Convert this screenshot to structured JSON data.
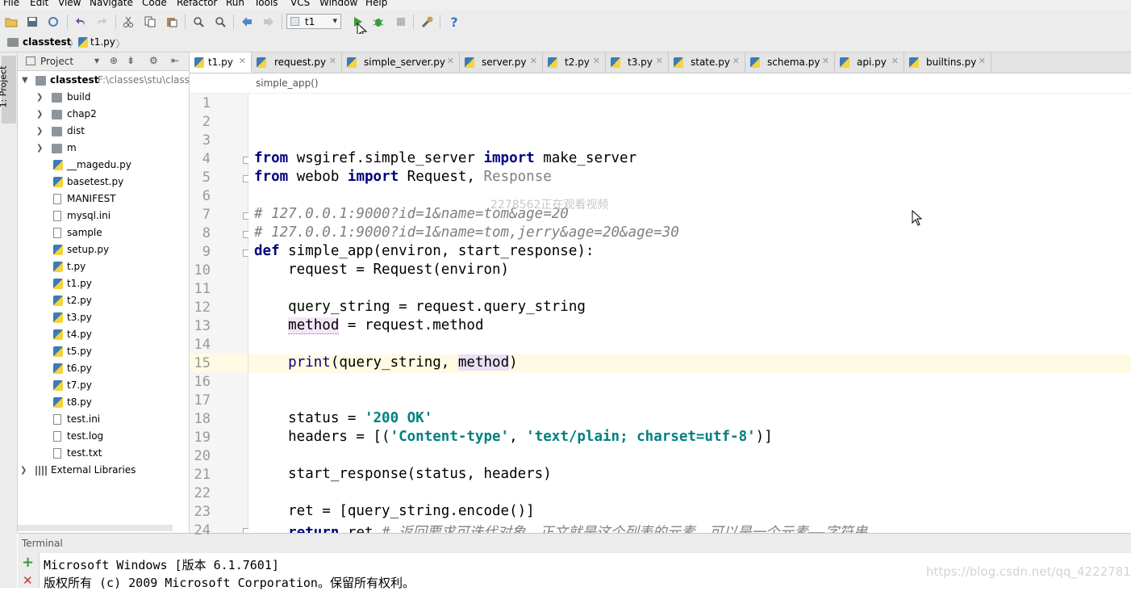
{
  "menu": [
    "File",
    "Edit",
    "View",
    "Navigate",
    "Code",
    "Refactor",
    "Run",
    "Tools",
    "VCS",
    "Window",
    "Help"
  ],
  "toolbar": {
    "run_config": "t1",
    "icons": [
      "open-icon",
      "save-icon",
      "sync-icon",
      "undo-icon",
      "redo-icon",
      "cut-icon",
      "copy-icon",
      "paste-icon",
      "find-icon",
      "replace-icon",
      "back-icon",
      "forward-icon",
      "run-icon",
      "debug-icon",
      "stop-icon",
      "settings-icon",
      "help-icon"
    ]
  },
  "navbar": {
    "project": "classtest",
    "file": "t1.py"
  },
  "stripe": {
    "label": "1: Project"
  },
  "project_panel": {
    "title": "Project",
    "root": {
      "name": "classtest",
      "path": "F:\\classes\\stu\\classt"
    },
    "items": [
      {
        "name": "build",
        "type": "folder"
      },
      {
        "name": "chap2",
        "type": "folder"
      },
      {
        "name": "dist",
        "type": "folder"
      },
      {
        "name": "m",
        "type": "folder"
      },
      {
        "name": "__magedu.py",
        "type": "py"
      },
      {
        "name": "basetest.py",
        "type": "py"
      },
      {
        "name": "MANIFEST",
        "type": "txt"
      },
      {
        "name": "mysql.ini",
        "type": "txt"
      },
      {
        "name": "sample",
        "type": "txt"
      },
      {
        "name": "setup.py",
        "type": "py"
      },
      {
        "name": "t.py",
        "type": "py"
      },
      {
        "name": "t1.py",
        "type": "py"
      },
      {
        "name": "t2.py",
        "type": "py"
      },
      {
        "name": "t3.py",
        "type": "py"
      },
      {
        "name": "t4.py",
        "type": "py"
      },
      {
        "name": "t5.py",
        "type": "py"
      },
      {
        "name": "t6.py",
        "type": "py"
      },
      {
        "name": "t7.py",
        "type": "py"
      },
      {
        "name": "t8.py",
        "type": "py"
      },
      {
        "name": "test.ini",
        "type": "txt"
      },
      {
        "name": "test.log",
        "type": "txt"
      },
      {
        "name": "test.txt",
        "type": "txt"
      }
    ],
    "external": "External Libraries"
  },
  "tabs": [
    "t1.py",
    "request.py",
    "simple_server.py",
    "server.py",
    "t2.py",
    "t3.py",
    "state.py",
    "schema.py",
    "api.py",
    "builtins.py"
  ],
  "active_tab": "t1.py",
  "breadcrumb": "simple_app()",
  "line_numbers": [
    "1",
    "2",
    "3",
    "4",
    "5",
    "6",
    "7",
    "8",
    "9",
    "10",
    "11",
    "12",
    "13",
    "14",
    "15",
    "16",
    "17",
    "18",
    "19",
    "20",
    "21",
    "22",
    "23",
    "24"
  ],
  "code": {
    "l4": {
      "kw1": "from",
      "t1": " wsgiref.simple_server ",
      "kw2": "import",
      "t2": " make_server"
    },
    "l5": {
      "kw1": "from",
      "t1": " webob ",
      "kw2": "import",
      "t2": " Request, ",
      "dim": "Response"
    },
    "l7": "# 127.0.0.1:9000?id=1&name=tom&age=20",
    "l8": "# 127.0.0.1:9000?id=1&name=tom,jerry&age=20&age=30",
    "l9": {
      "kw": "def",
      "t": " simple_app(environ, start_response):"
    },
    "l10": "    request = Request(environ)",
    "l12": "    query_string = request.query_string",
    "l13": {
      "pre": "    ",
      "hl": "method",
      "post": " = request.method"
    },
    "l15": {
      "pre": "    ",
      "fn": "print",
      "a": "(query_string, ",
      "hl": "method",
      "b": ")"
    },
    "l18": {
      "pre": "    status = ",
      "str": "'200 OK'"
    },
    "l19": {
      "pre": "    headers = [(",
      "s1": "'Content-type'",
      "mid": ", ",
      "s2": "'text/plain; charset=utf-8'",
      "post": ")]"
    },
    "l21": "    start_response(status, headers)",
    "l23": "    ret = [query_string.encode()]",
    "l24": {
      "pre": "    ",
      "kw": "return",
      "t": " ret ",
      "cm": "# 返回要求可迭代对象，正文就是这个列表的元素，可以是一个元素——字符串"
    }
  },
  "watermark": "2278562正在观看视频",
  "terminal": {
    "title": "Terminal",
    "lines": [
      "Microsoft Windows [版本 6.1.7601]",
      "版权所有 (c) 2009 Microsoft Corporation。保留所有权利。"
    ]
  },
  "csdn_watermark": "https://blog.csdn.net/qq_42227818"
}
